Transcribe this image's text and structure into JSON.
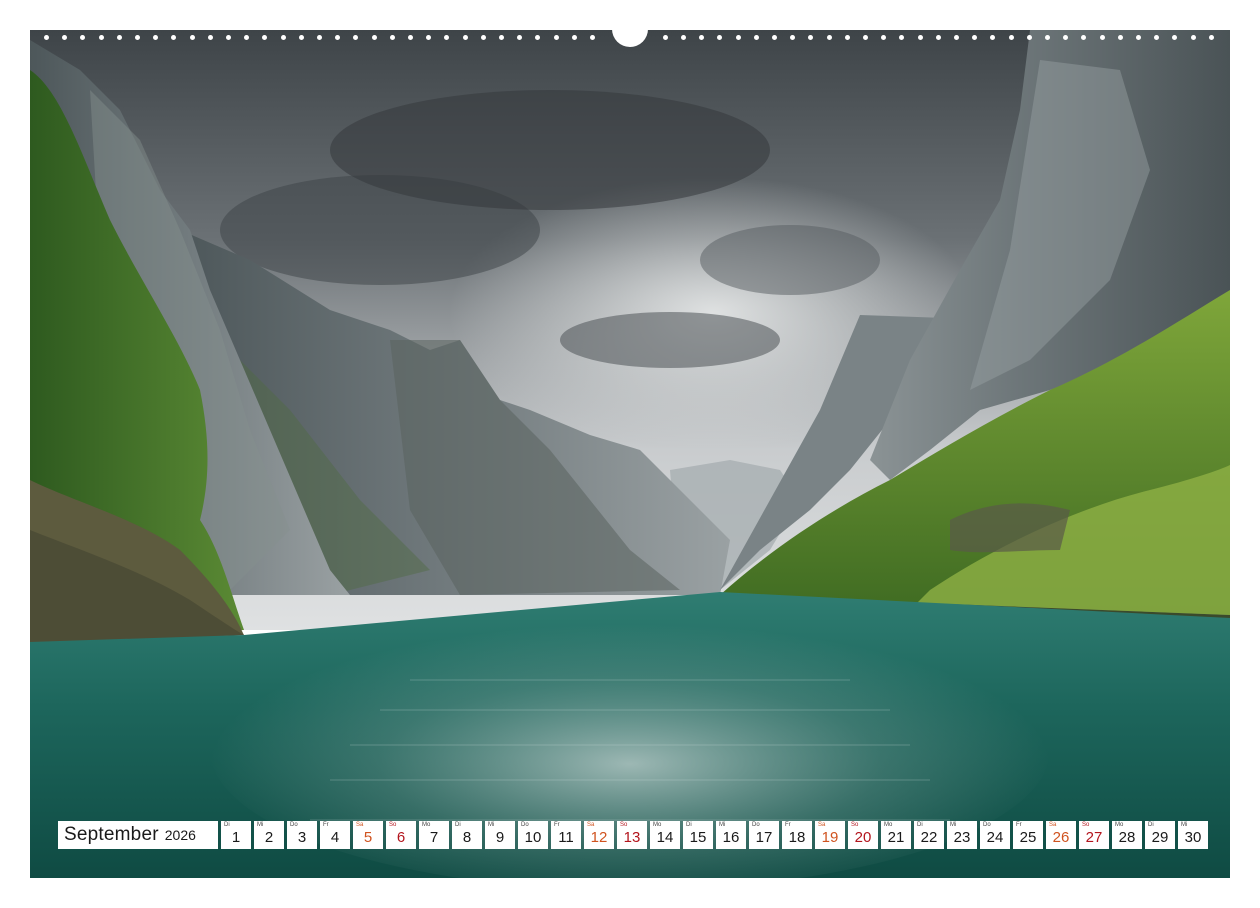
{
  "calendar": {
    "month": "September",
    "year": "2026",
    "days": [
      {
        "abbr": "Di",
        "num": "1",
        "type": "weekday"
      },
      {
        "abbr": "Mi",
        "num": "2",
        "type": "weekday"
      },
      {
        "abbr": "Do",
        "num": "3",
        "type": "weekday"
      },
      {
        "abbr": "Fr",
        "num": "4",
        "type": "weekday"
      },
      {
        "abbr": "Sa",
        "num": "5",
        "type": "sat"
      },
      {
        "abbr": "So",
        "num": "6",
        "type": "sun"
      },
      {
        "abbr": "Mo",
        "num": "7",
        "type": "weekday"
      },
      {
        "abbr": "Di",
        "num": "8",
        "type": "weekday"
      },
      {
        "abbr": "Mi",
        "num": "9",
        "type": "weekday"
      },
      {
        "abbr": "Do",
        "num": "10",
        "type": "weekday"
      },
      {
        "abbr": "Fr",
        "num": "11",
        "type": "weekday"
      },
      {
        "abbr": "Sa",
        "num": "12",
        "type": "sat"
      },
      {
        "abbr": "So",
        "num": "13",
        "type": "sun"
      },
      {
        "abbr": "Mo",
        "num": "14",
        "type": "weekday"
      },
      {
        "abbr": "Di",
        "num": "15",
        "type": "weekday"
      },
      {
        "abbr": "Mi",
        "num": "16",
        "type": "weekday"
      },
      {
        "abbr": "Do",
        "num": "17",
        "type": "weekday"
      },
      {
        "abbr": "Fr",
        "num": "18",
        "type": "weekday"
      },
      {
        "abbr": "Sa",
        "num": "19",
        "type": "sat"
      },
      {
        "abbr": "So",
        "num": "20",
        "type": "sun"
      },
      {
        "abbr": "Mo",
        "num": "21",
        "type": "weekday"
      },
      {
        "abbr": "Di",
        "num": "22",
        "type": "weekday"
      },
      {
        "abbr": "Mi",
        "num": "23",
        "type": "weekday"
      },
      {
        "abbr": "Do",
        "num": "24",
        "type": "weekday"
      },
      {
        "abbr": "Fr",
        "num": "25",
        "type": "weekday"
      },
      {
        "abbr": "Sa",
        "num": "26",
        "type": "sat"
      },
      {
        "abbr": "So",
        "num": "27",
        "type": "sun"
      },
      {
        "abbr": "Mo",
        "num": "28",
        "type": "weekday"
      },
      {
        "abbr": "Di",
        "num": "29",
        "type": "weekday"
      },
      {
        "abbr": "Mi",
        "num": "30",
        "type": "weekday"
      }
    ]
  },
  "colors": {
    "saturday": "#d0531f",
    "sunday": "#b3141c",
    "water": "#1f6b62",
    "sky": "#8a9094",
    "cliffs": "#5d6669",
    "greenery": "#5f8f2c"
  },
  "photo_subject": "fjord-landscape"
}
